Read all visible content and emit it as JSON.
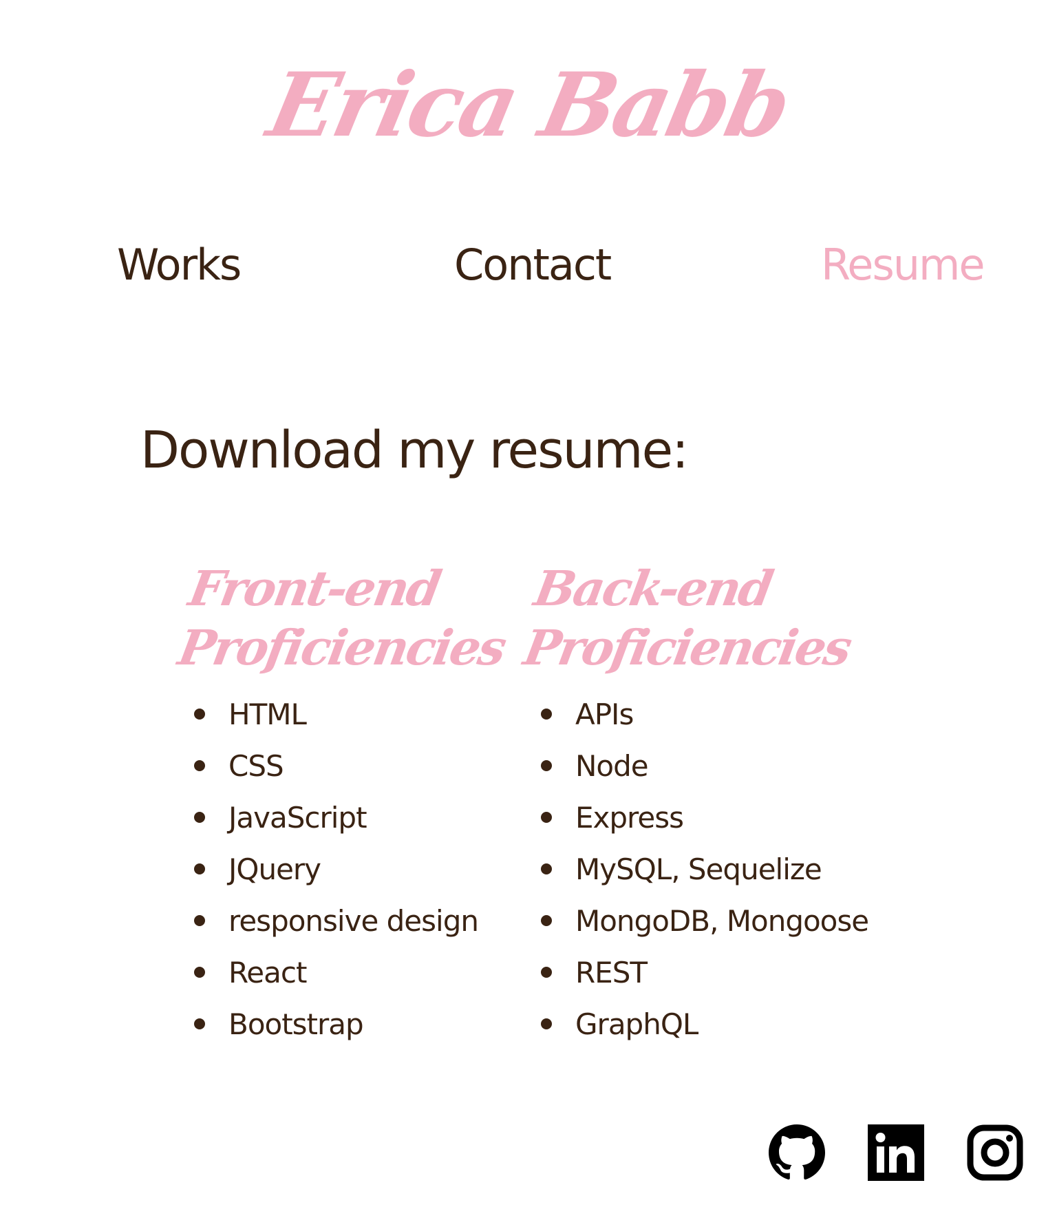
{
  "header": {
    "logo_text": "Erica Babb"
  },
  "nav": {
    "items": [
      {
        "label": "Works"
      },
      {
        "label": "Contact"
      },
      {
        "label": "Resume",
        "active": true
      }
    ]
  },
  "main": {
    "download_label": "Download my resume:",
    "front_end": {
      "heading_line1": "Front-end",
      "heading_line2": "Proficiencies",
      "items": [
        "HTML",
        "CSS",
        "JavaScript",
        "JQuery",
        "responsive design",
        "React",
        "Bootstrap"
      ]
    },
    "back_end": {
      "heading_line1": "Back-end",
      "heading_line2": "Proficiencies",
      "items": [
        "APIs",
        "Node",
        "Express",
        "MySQL, Sequelize",
        "MongoDB, Mongoose",
        "REST",
        "GraphQL"
      ]
    }
  },
  "footer": {
    "social_icons": [
      "github-icon",
      "linkedin-icon",
      "instagram-icon"
    ]
  },
  "colors": {
    "accent_pink": "#f3adc1",
    "text_brown": "#3a2313",
    "icon_black": "#000000",
    "background": "#ffffff"
  }
}
